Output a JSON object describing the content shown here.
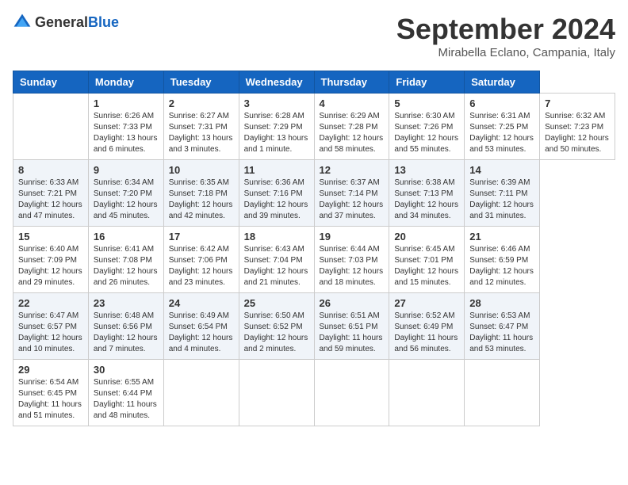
{
  "header": {
    "logo_general": "General",
    "logo_blue": "Blue",
    "month_year": "September 2024",
    "location": "Mirabella Eclano, Campania, Italy"
  },
  "calendar": {
    "days_of_week": [
      "Sunday",
      "Monday",
      "Tuesday",
      "Wednesday",
      "Thursday",
      "Friday",
      "Saturday"
    ],
    "weeks": [
      [
        null,
        {
          "day": "1",
          "sunrise": "Sunrise: 6:26 AM",
          "sunset": "Sunset: 7:33 PM",
          "daylight": "Daylight: 13 hours and 6 minutes."
        },
        {
          "day": "2",
          "sunrise": "Sunrise: 6:27 AM",
          "sunset": "Sunset: 7:31 PM",
          "daylight": "Daylight: 13 hours and 3 minutes."
        },
        {
          "day": "3",
          "sunrise": "Sunrise: 6:28 AM",
          "sunset": "Sunset: 7:29 PM",
          "daylight": "Daylight: 13 hours and 1 minute."
        },
        {
          "day": "4",
          "sunrise": "Sunrise: 6:29 AM",
          "sunset": "Sunset: 7:28 PM",
          "daylight": "Daylight: 12 hours and 58 minutes."
        },
        {
          "day": "5",
          "sunrise": "Sunrise: 6:30 AM",
          "sunset": "Sunset: 7:26 PM",
          "daylight": "Daylight: 12 hours and 55 minutes."
        },
        {
          "day": "6",
          "sunrise": "Sunrise: 6:31 AM",
          "sunset": "Sunset: 7:25 PM",
          "daylight": "Daylight: 12 hours and 53 minutes."
        },
        {
          "day": "7",
          "sunrise": "Sunrise: 6:32 AM",
          "sunset": "Sunset: 7:23 PM",
          "daylight": "Daylight: 12 hours and 50 minutes."
        }
      ],
      [
        {
          "day": "8",
          "sunrise": "Sunrise: 6:33 AM",
          "sunset": "Sunset: 7:21 PM",
          "daylight": "Daylight: 12 hours and 47 minutes."
        },
        {
          "day": "9",
          "sunrise": "Sunrise: 6:34 AM",
          "sunset": "Sunset: 7:20 PM",
          "daylight": "Daylight: 12 hours and 45 minutes."
        },
        {
          "day": "10",
          "sunrise": "Sunrise: 6:35 AM",
          "sunset": "Sunset: 7:18 PM",
          "daylight": "Daylight: 12 hours and 42 minutes."
        },
        {
          "day": "11",
          "sunrise": "Sunrise: 6:36 AM",
          "sunset": "Sunset: 7:16 PM",
          "daylight": "Daylight: 12 hours and 39 minutes."
        },
        {
          "day": "12",
          "sunrise": "Sunrise: 6:37 AM",
          "sunset": "Sunset: 7:14 PM",
          "daylight": "Daylight: 12 hours and 37 minutes."
        },
        {
          "day": "13",
          "sunrise": "Sunrise: 6:38 AM",
          "sunset": "Sunset: 7:13 PM",
          "daylight": "Daylight: 12 hours and 34 minutes."
        },
        {
          "day": "14",
          "sunrise": "Sunrise: 6:39 AM",
          "sunset": "Sunset: 7:11 PM",
          "daylight": "Daylight: 12 hours and 31 minutes."
        }
      ],
      [
        {
          "day": "15",
          "sunrise": "Sunrise: 6:40 AM",
          "sunset": "Sunset: 7:09 PM",
          "daylight": "Daylight: 12 hours and 29 minutes."
        },
        {
          "day": "16",
          "sunrise": "Sunrise: 6:41 AM",
          "sunset": "Sunset: 7:08 PM",
          "daylight": "Daylight: 12 hours and 26 minutes."
        },
        {
          "day": "17",
          "sunrise": "Sunrise: 6:42 AM",
          "sunset": "Sunset: 7:06 PM",
          "daylight": "Daylight: 12 hours and 23 minutes."
        },
        {
          "day": "18",
          "sunrise": "Sunrise: 6:43 AM",
          "sunset": "Sunset: 7:04 PM",
          "daylight": "Daylight: 12 hours and 21 minutes."
        },
        {
          "day": "19",
          "sunrise": "Sunrise: 6:44 AM",
          "sunset": "Sunset: 7:03 PM",
          "daylight": "Daylight: 12 hours and 18 minutes."
        },
        {
          "day": "20",
          "sunrise": "Sunrise: 6:45 AM",
          "sunset": "Sunset: 7:01 PM",
          "daylight": "Daylight: 12 hours and 15 minutes."
        },
        {
          "day": "21",
          "sunrise": "Sunrise: 6:46 AM",
          "sunset": "Sunset: 6:59 PM",
          "daylight": "Daylight: 12 hours and 12 minutes."
        }
      ],
      [
        {
          "day": "22",
          "sunrise": "Sunrise: 6:47 AM",
          "sunset": "Sunset: 6:57 PM",
          "daylight": "Daylight: 12 hours and 10 minutes."
        },
        {
          "day": "23",
          "sunrise": "Sunrise: 6:48 AM",
          "sunset": "Sunset: 6:56 PM",
          "daylight": "Daylight: 12 hours and 7 minutes."
        },
        {
          "day": "24",
          "sunrise": "Sunrise: 6:49 AM",
          "sunset": "Sunset: 6:54 PM",
          "daylight": "Daylight: 12 hours and 4 minutes."
        },
        {
          "day": "25",
          "sunrise": "Sunrise: 6:50 AM",
          "sunset": "Sunset: 6:52 PM",
          "daylight": "Daylight: 12 hours and 2 minutes."
        },
        {
          "day": "26",
          "sunrise": "Sunrise: 6:51 AM",
          "sunset": "Sunset: 6:51 PM",
          "daylight": "Daylight: 11 hours and 59 minutes."
        },
        {
          "day": "27",
          "sunrise": "Sunrise: 6:52 AM",
          "sunset": "Sunset: 6:49 PM",
          "daylight": "Daylight: 11 hours and 56 minutes."
        },
        {
          "day": "28",
          "sunrise": "Sunrise: 6:53 AM",
          "sunset": "Sunset: 6:47 PM",
          "daylight": "Daylight: 11 hours and 53 minutes."
        }
      ],
      [
        {
          "day": "29",
          "sunrise": "Sunrise: 6:54 AM",
          "sunset": "Sunset: 6:45 PM",
          "daylight": "Daylight: 11 hours and 51 minutes."
        },
        {
          "day": "30",
          "sunrise": "Sunrise: 6:55 AM",
          "sunset": "Sunset: 6:44 PM",
          "daylight": "Daylight: 11 hours and 48 minutes."
        },
        null,
        null,
        null,
        null,
        null
      ]
    ]
  }
}
